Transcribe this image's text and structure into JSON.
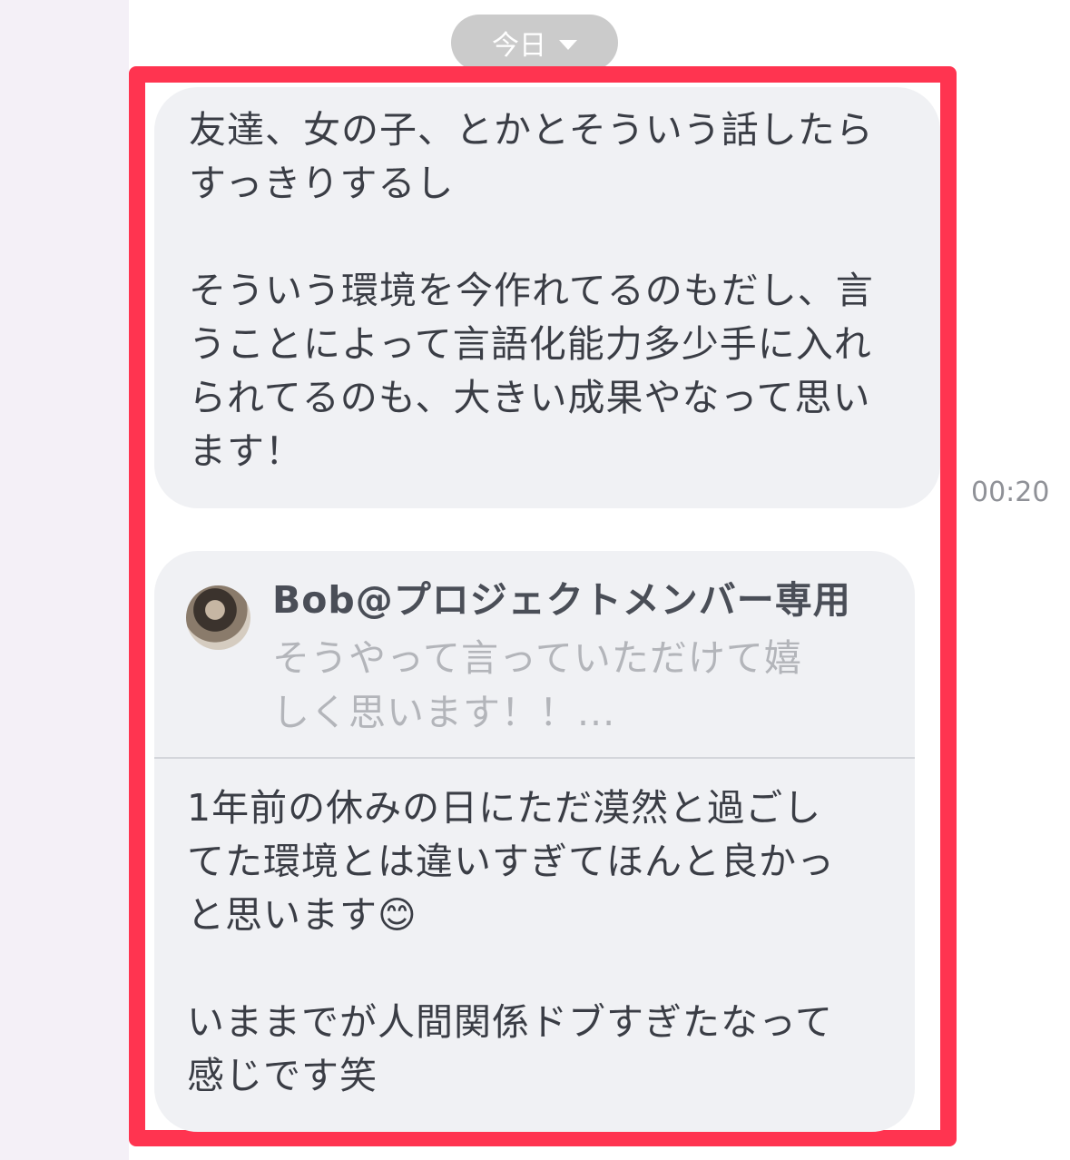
{
  "date_chip": {
    "label": "今日",
    "icon": "chevron-down-icon"
  },
  "messages": [
    {
      "text": "友達、女の子、とかとそういう話したら\nすっきりするし\n\nそういう環境を今作れてるのもだし、言\nうことによって言語化能力多少手に入れ\nられてるのも、大きい成果やなって思い\nます！",
      "time": "00:20"
    },
    {
      "reply": {
        "name": "Bob@プロジェクトメンバー専用",
        "preview": "そうやって言っていただけて嬉\nしく思います！！..."
      },
      "text_before_emoji": "1年前の休みの日にただ漠然と過ごし\nてた環境とは違いすぎてほんと良かっ\nと思います",
      "emoji": "😊",
      "text_after_emoji": "\n\nいままでが人間関係ドブすぎたなって\n感じです笑"
    }
  ],
  "colors": {
    "highlight_border": "#ff3450",
    "bubble_bg": "#f0f1f4",
    "side_panel_bg": "#f4f0f7",
    "date_chip_bg": "#cbcbcb"
  }
}
